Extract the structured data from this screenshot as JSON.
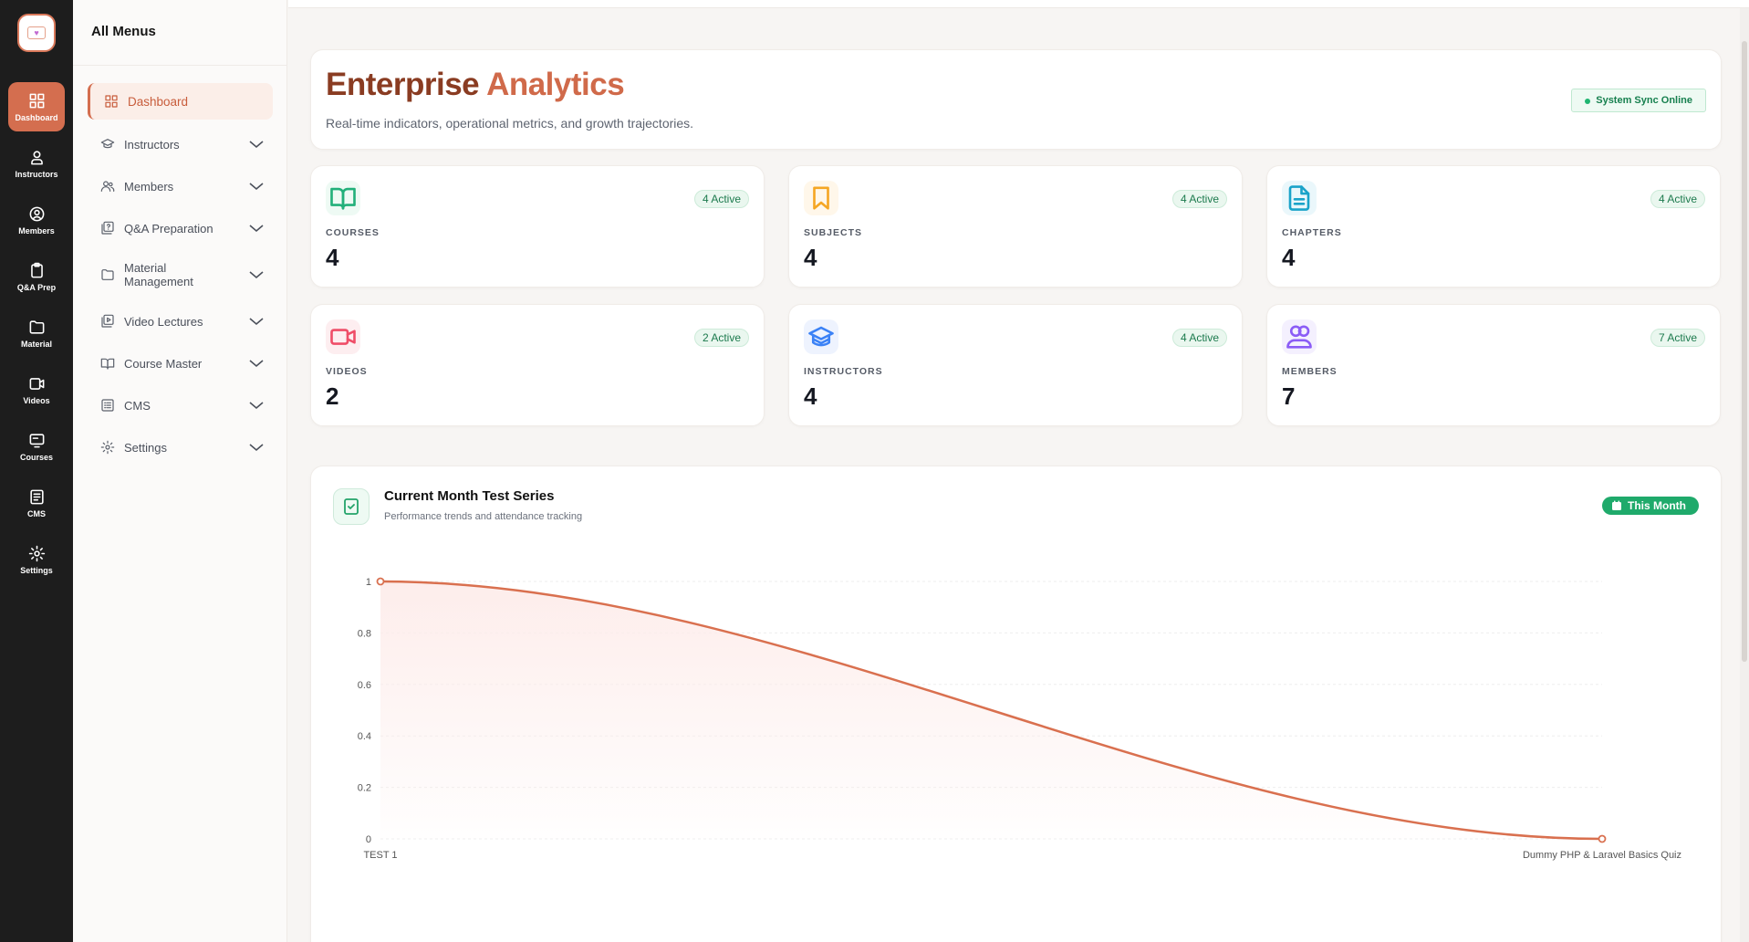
{
  "rail": {
    "items": [
      {
        "label": "Dashboard",
        "icon": "grid-icon",
        "active": true
      },
      {
        "label": "Instructors",
        "icon": "user-icon"
      },
      {
        "label": "Members",
        "icon": "user-circle-icon"
      },
      {
        "label": "Q&A Prep",
        "icon": "clipboard-icon"
      },
      {
        "label": "Material",
        "icon": "folder-icon"
      },
      {
        "label": "Videos",
        "icon": "video-icon"
      },
      {
        "label": "Courses",
        "icon": "monitor-icon"
      },
      {
        "label": "CMS",
        "icon": "document-list-icon"
      },
      {
        "label": "Settings",
        "icon": "gear-icon"
      }
    ]
  },
  "menu": {
    "title": "All Menus",
    "items": [
      {
        "label": "Dashboard",
        "icon": "grid-icon"
      },
      {
        "label": "Instructors",
        "icon": "graduation-cap-icon"
      },
      {
        "label": "Members",
        "icon": "users-icon"
      },
      {
        "label": "Q&A Preparation",
        "icon": "question-box-icon"
      },
      {
        "label": "Material Management",
        "icon": "folder-icon"
      },
      {
        "label": "Video Lectures",
        "icon": "play-box-icon"
      },
      {
        "label": "Course Master",
        "icon": "book-open-icon"
      },
      {
        "label": "CMS",
        "icon": "document-list-icon"
      },
      {
        "label": "Settings",
        "icon": "gear-icon"
      }
    ]
  },
  "hero": {
    "title_part1": "Enterprise",
    "title_part2": "Analytics",
    "subtitle": "Real-time indicators, operational metrics, and growth trajectories.",
    "status": "System Sync Online"
  },
  "stats": [
    {
      "label": "COURSES",
      "value": "4",
      "badge": "4 Active",
      "icon": "book-open-icon",
      "color": "#22b07a"
    },
    {
      "label": "SUBJECTS",
      "value": "4",
      "badge": "4 Active",
      "icon": "bookmark-icon",
      "color": "#f5a623"
    },
    {
      "label": "CHAPTERS",
      "value": "4",
      "badge": "4 Active",
      "icon": "file-text-icon",
      "color": "#1aa3c9"
    },
    {
      "label": "VIDEOS",
      "value": "2",
      "badge": "2 Active",
      "icon": "video-icon",
      "color": "#ef4e68"
    },
    {
      "label": "INSTRUCTORS",
      "value": "4",
      "badge": "4 Active",
      "icon": "graduation-cap-icon",
      "color": "#3b82f6"
    },
    {
      "label": "MEMBERS",
      "value": "7",
      "badge": "7 Active",
      "icon": "users-icon",
      "color": "#8b5cf6"
    }
  ],
  "chart_panel": {
    "title": "Current Month Test Series",
    "subtitle": "Performance trends and attendance tracking",
    "pill": "This Month"
  },
  "chart_data": {
    "type": "area",
    "categories": [
      "TEST 1",
      "Dummy PHP & Laravel Basics Quiz"
    ],
    "values": [
      1,
      0
    ],
    "yticks": [
      "0",
      "0.2",
      "0.4",
      "0.6",
      "0.8",
      "1"
    ],
    "ylim": [
      0,
      1
    ],
    "grid": true,
    "line_color": "#d9704f",
    "fill_color": "#fdecea"
  }
}
